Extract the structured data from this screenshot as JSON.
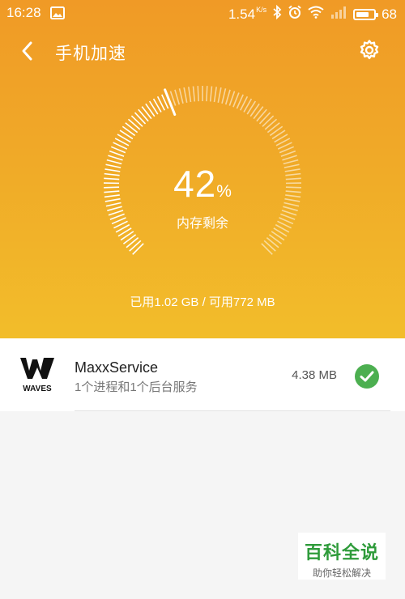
{
  "status_bar": {
    "time": "16:28",
    "net_speed": "1.54",
    "net_speed_unit": "K/s",
    "battery": "68",
    "icons": [
      "image-icon",
      "bluetooth-icon",
      "alarm-icon",
      "wifi-icon",
      "signal-icon",
      "battery-icon"
    ]
  },
  "header": {
    "title": "手机加速",
    "back_icon": "chevron-left-icon",
    "settings_icon": "gear-icon"
  },
  "gauge": {
    "percent": "42",
    "percent_sign": "%",
    "percent_value": 42,
    "label": "内存剩余",
    "usage": "已用1.02 GB / 可用772 MB"
  },
  "processes": [
    {
      "name": "MaxxService",
      "detail": "1个进程和1个后台服务",
      "size": "4.38 MB",
      "checked": true,
      "logo_text": "WAVES"
    }
  ],
  "watermark": {
    "title": "百科全说",
    "subtitle": "助你轻松解决"
  },
  "colors": {
    "hero_top": "#f09a26",
    "hero_bottom": "#f2bd2a",
    "check": "#4caf50",
    "watermark_green": "#2e9b3a"
  }
}
